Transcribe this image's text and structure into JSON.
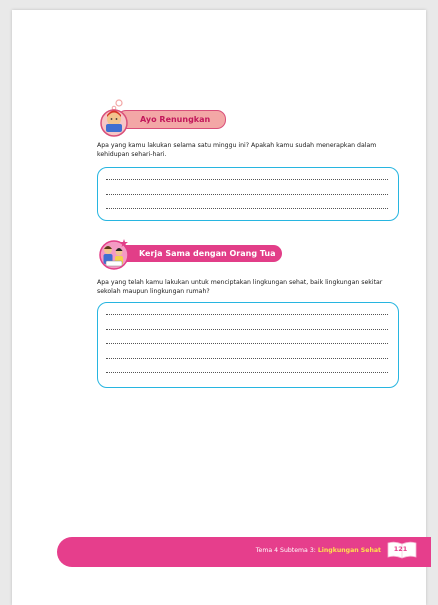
{
  "section_reflect": {
    "title": "Ayo Renungkan",
    "question": "Apa yang kamu lakukan selama satu minggu ini? Apakah kamu sudah menerapkan dalam kehidupan sehari-hari."
  },
  "section_parents": {
    "title": "Kerja Sama dengan Orang Tua",
    "question": "Apa yang telah kamu lakukan untuk menciptakan lingkungan sehat, baik lingkungan sekitar sekolah maupun lingkungan rumah?"
  },
  "footer": {
    "prefix": "Tema 4 Subtema 3:",
    "subtitle": "Lingkungan Sehat",
    "page_number": "121"
  },
  "colors": {
    "accent_pink": "#e63e8c",
    "box_border": "#27b5e0"
  },
  "icons": [
    "thinking-girl-icon",
    "family-icon"
  ]
}
